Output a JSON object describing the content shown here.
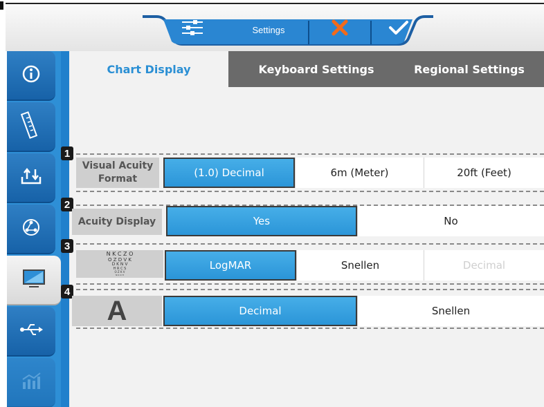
{
  "header": {
    "title": "Settings",
    "filter_icon": "sliders-icon",
    "cancel_icon": "close-icon",
    "confirm_icon": "check-icon"
  },
  "nav": {
    "items": [
      {
        "icon": "info-icon",
        "active": false
      },
      {
        "icon": "ruler-icon",
        "active": false
      },
      {
        "icon": "upload-download-icon",
        "active": false
      },
      {
        "icon": "network-icon",
        "active": false
      },
      {
        "icon": "monitor-icon",
        "active": true
      },
      {
        "icon": "usb-icon",
        "active": false
      },
      {
        "icon": "chart-icon",
        "active": false,
        "disabled": true
      }
    ]
  },
  "tabs": [
    "Chart Display",
    "Keyboard Settings",
    "Regional Settings"
  ],
  "rows": [
    {
      "number": "1",
      "label": "Visual Acuity Format",
      "options": [
        "(1.0) Decimal",
        "6m (Meter)",
        "20ft (Feet)"
      ],
      "selected": "(1.0) Decimal"
    },
    {
      "number": "2",
      "label": "Acuity Display",
      "options": [
        "Yes",
        "No"
      ],
      "selected": "Yes"
    },
    {
      "number": "3",
      "label_icon": "eye-chart-icon",
      "eye_chart_lines": [
        "N K C Z O",
        "O Z D V K",
        "D K N V",
        "H R C S",
        "O Z K V",
        "N K O H"
      ],
      "options": [
        "LogMAR",
        "Snellen",
        "Decimal"
      ],
      "selected": "LogMAR",
      "disabled": [
        "Decimal"
      ]
    },
    {
      "number": "4",
      "label": "A",
      "options": [
        "Decimal",
        "Snellen"
      ],
      "selected": "Decimal"
    }
  ],
  "colors": {
    "accent": "#2e8fd6",
    "selected": "#3aa0e0",
    "tab_inactive": "#6a6a6a",
    "header_cancel": "#f26a1b"
  }
}
